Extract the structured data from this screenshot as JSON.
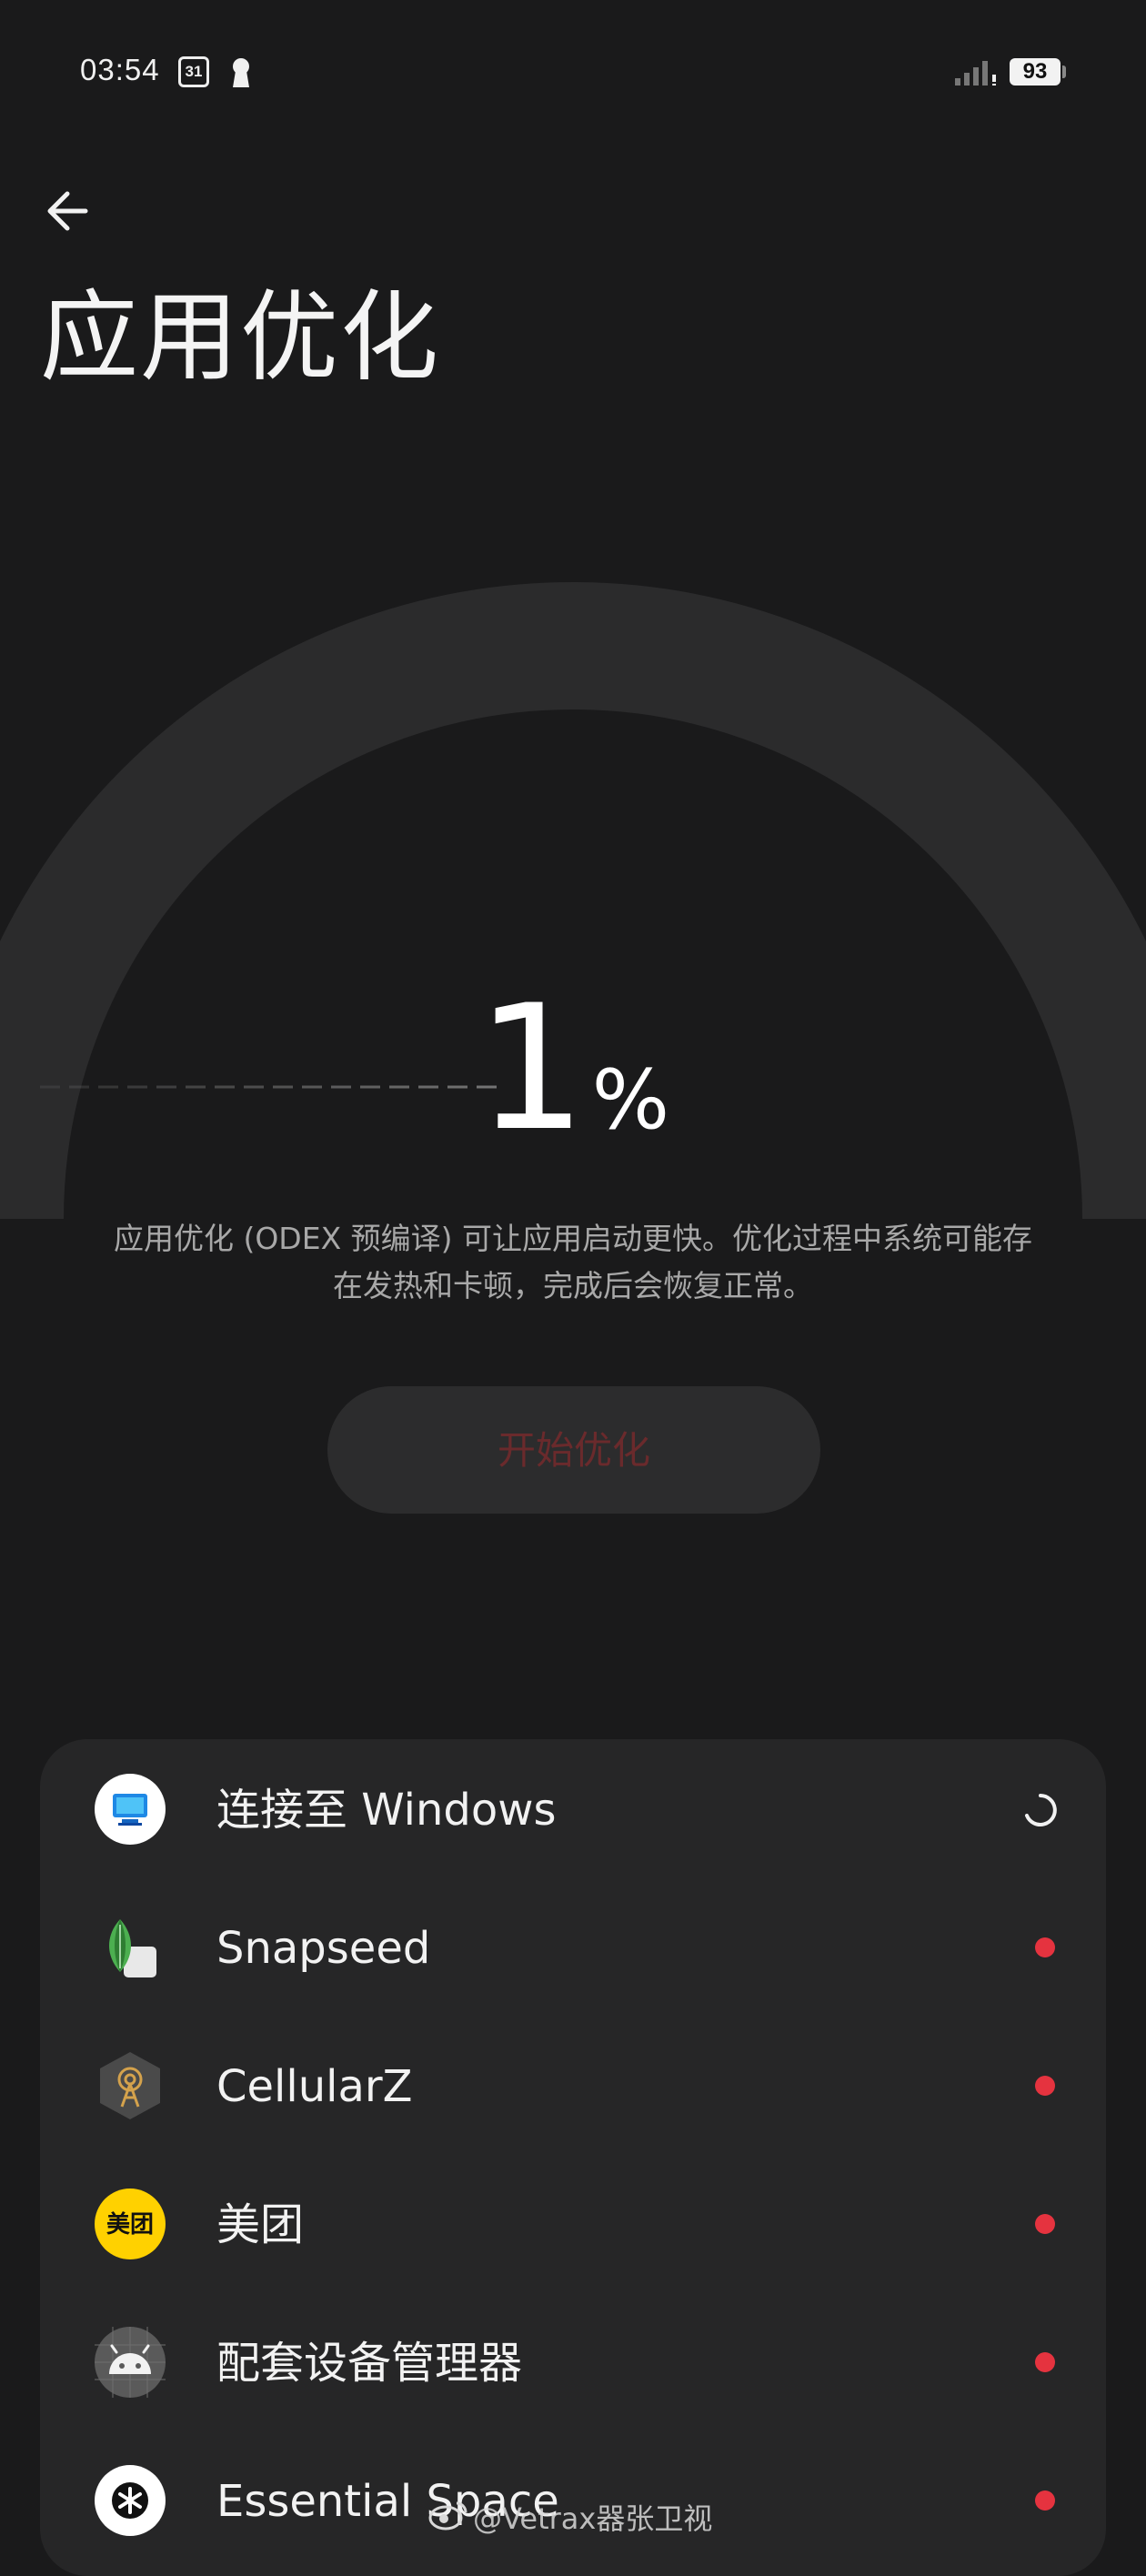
{
  "status_bar": {
    "time": "03:54",
    "calendar_day": "31",
    "battery": "93"
  },
  "header": {
    "title": "应用优化"
  },
  "progress": {
    "value": "1",
    "unit": "%",
    "fraction": 0.01
  },
  "description": {
    "line1": "应用优化 (ODEX 预编译) 可让应用启动更快。优化过程中系统可能存",
    "line2": "在发热和卡顿，完成后会恢复正常。"
  },
  "start_button": {
    "label": "开始优化"
  },
  "apps": [
    {
      "name": "连接至 Windows",
      "icon": "link-to-windows-icon",
      "status": "loading"
    },
    {
      "name": "Snapseed",
      "icon": "snapseed-icon",
      "status": "pending"
    },
    {
      "name": "CellularZ",
      "icon": "cellularz-icon",
      "status": "pending"
    },
    {
      "name": "美团",
      "icon": "meituan-icon",
      "status": "pending",
      "icon_text": "美团"
    },
    {
      "name": "配套设备管理器",
      "icon": "android-icon",
      "status": "pending"
    },
    {
      "name": "Essential Space",
      "icon": "essential-space-icon",
      "status": "pending"
    }
  ],
  "watermark": {
    "text": "@Vetrax器张卫视"
  },
  "colors": {
    "background": "#1a1a1b",
    "card": "#262627",
    "pending_dot": "#e5333f",
    "start_button_text": "#6a2a2c"
  }
}
